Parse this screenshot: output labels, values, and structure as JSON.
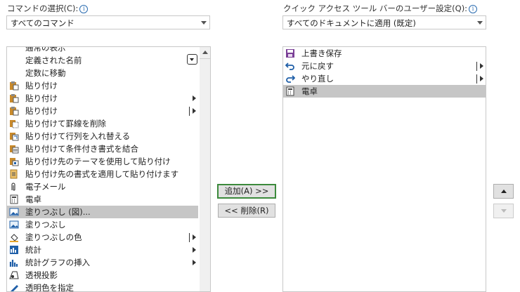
{
  "left": {
    "label": "コマンドの選択(C):",
    "dropdown_value": "すべてのコマンド",
    "items": [
      {
        "label": "通常の表示",
        "icon": "scrolled-item-icon",
        "submenu": false,
        "partial": true
      },
      {
        "label": "定義された名前",
        "icon": "",
        "submenu": false
      },
      {
        "label": "定数に移動",
        "icon": "",
        "submenu": false
      },
      {
        "label": "貼り付け",
        "icon": "paste-icon",
        "submenu": false
      },
      {
        "label": "貼り付け",
        "icon": "paste-icon",
        "submenu": true
      },
      {
        "label": "貼り付け",
        "icon": "paste-icon",
        "submenu": true,
        "separator": true
      },
      {
        "label": "貼り付けて罫線を削除",
        "icon": "paste-no-borders-icon",
        "submenu": false
      },
      {
        "label": "貼り付けて行列を入れ替える",
        "icon": "paste-transpose-icon",
        "submenu": false
      },
      {
        "label": "貼り付けて条件付き書式を結合",
        "icon": "paste-merge-format-icon",
        "submenu": false
      },
      {
        "label": "貼り付け先のテーマを使用して貼り付け",
        "icon": "paste-theme-icon",
        "submenu": false
      },
      {
        "label": "貼り付け先の書式を適用して貼り付けます",
        "icon": "paste-dest-format-icon",
        "submenu": false
      },
      {
        "label": "電子メール",
        "icon": "attachment-icon",
        "submenu": false
      },
      {
        "label": "電卓",
        "icon": "calculator-icon",
        "submenu": false
      },
      {
        "label": "塗りつぶし (図)...",
        "icon": "picture-fill-icon",
        "submenu": false,
        "selected": true
      },
      {
        "label": "塗りつぶし",
        "icon": "picture-icon",
        "submenu": false
      },
      {
        "label": "塗りつぶしの色",
        "icon": "paint-bucket-icon",
        "submenu": true,
        "separator": true
      },
      {
        "label": "統計",
        "icon": "stats-chart-icon",
        "submenu": true
      },
      {
        "label": "統計グラフの挿入",
        "icon": "insert-stats-chart-icon",
        "submenu": true
      },
      {
        "label": "透視投影",
        "icon": "perspective-icon",
        "submenu": false
      },
      {
        "label": "透明色を指定",
        "icon": "transparent-color-icon",
        "submenu": false,
        "partial": true
      }
    ]
  },
  "right": {
    "label": "クイック アクセス ツール バーのユーザー設定(Q):",
    "dropdown_value": "すべてのドキュメントに適用 (既定)",
    "items": [
      {
        "label": "上書き保存",
        "icon": "save-icon",
        "submenu": false
      },
      {
        "label": "元に戻す",
        "icon": "undo-icon",
        "submenu": true,
        "separator": true
      },
      {
        "label": "やり直し",
        "icon": "redo-icon",
        "submenu": true,
        "separator": true
      },
      {
        "label": "電卓",
        "icon": "calculator-icon",
        "submenu": false,
        "selected": true
      }
    ]
  },
  "buttons": {
    "add": "追加(A) >>",
    "remove": "<< 削除(R)"
  },
  "info_glyph": "i",
  "colors": {
    "selection": "#c6c6c6",
    "focus_border": "#3c8a3c",
    "icon_blue": "#1f5fa8",
    "icon_purple": "#7a3f96"
  }
}
